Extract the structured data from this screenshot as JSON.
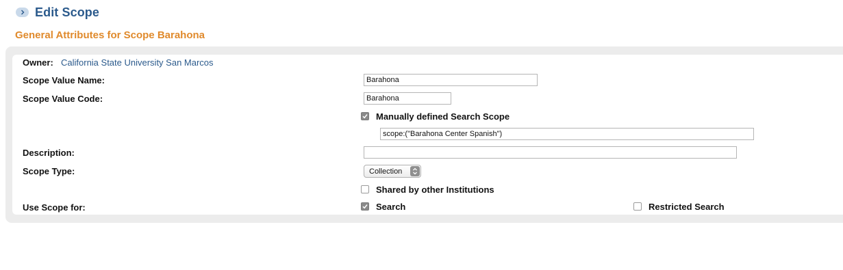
{
  "header": {
    "title": "Edit Scope",
    "icon": "chevron-right-icon"
  },
  "section": {
    "title": "General Attributes for Scope Barahona"
  },
  "form": {
    "owner_label": "Owner:",
    "owner_value": "California State University San Marcos",
    "scope_value_name_label": "Scope Value Name:",
    "scope_value_name": "Barahona",
    "scope_value_code_label": "Scope Value Code:",
    "scope_value_code": "Barahona",
    "manual_scope_label": "Manually defined Search Scope",
    "manual_scope_checked": true,
    "manual_scope_query": "scope:(\"Barahona Center Spanish\")",
    "description_label": "Description:",
    "description_value": "",
    "scope_type_label": "Scope Type:",
    "scope_type_selected": "Collection",
    "shared_label": "Shared by other Institutions",
    "shared_checked": false,
    "use_scope_label": "Use Scope for:",
    "search_label": "Search",
    "search_checked": true,
    "restricted_search_label": "Restricted Search",
    "restricted_search_checked": false
  },
  "colors": {
    "title": "#2b5a8c",
    "section_title": "#e08a2c",
    "panel_bg": "#ececec",
    "link": "#2b5a8c"
  }
}
